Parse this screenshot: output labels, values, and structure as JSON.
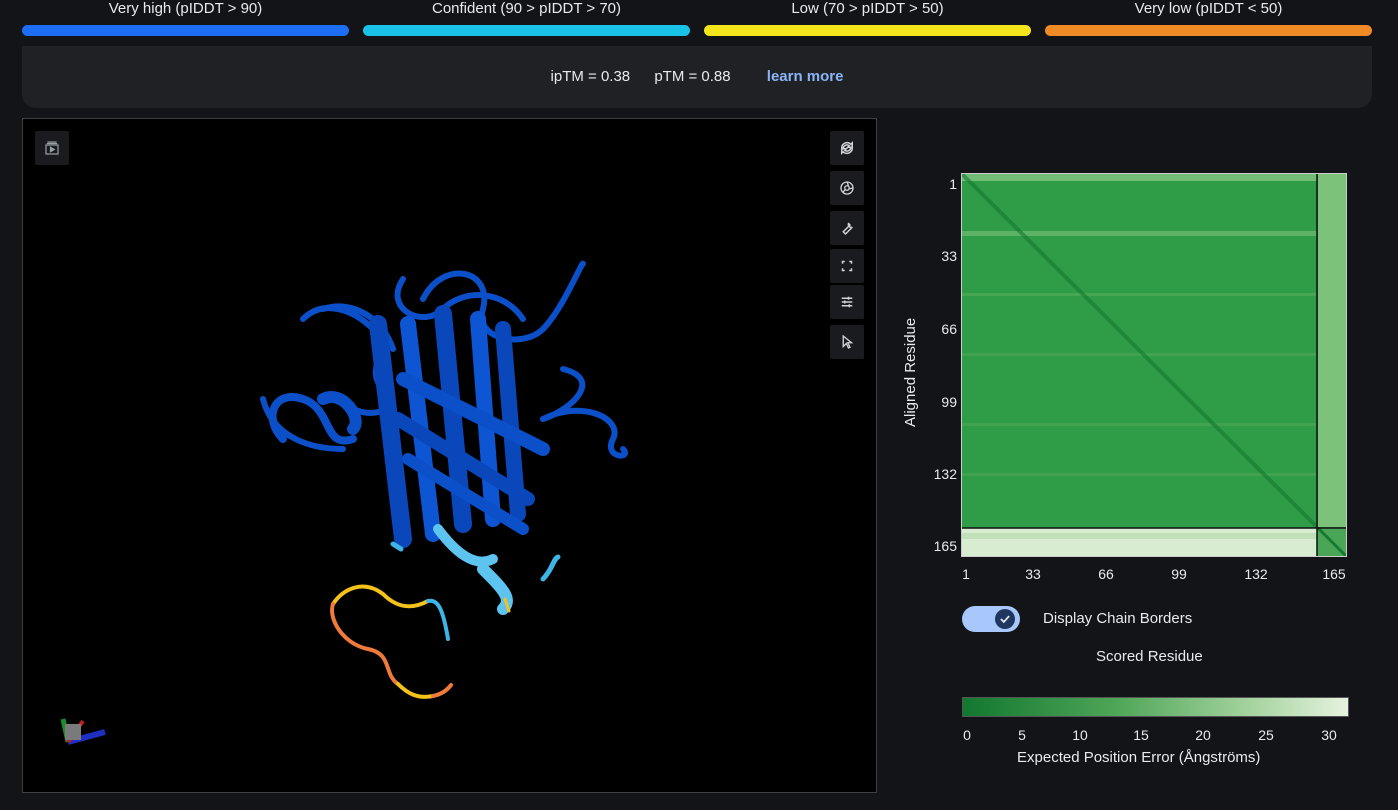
{
  "legend": [
    {
      "label": "Very high (pIDDT > 90)",
      "color": "#1e6ef5"
    },
    {
      "label": "Confident (90 > pIDDT > 70)",
      "color": "#19c3e8"
    },
    {
      "label": "Low (70 > pIDDT > 50)",
      "color": "#f5e51d"
    },
    {
      "label": "Very low (pIDDT < 50)",
      "color": "#f08a25"
    }
  ],
  "scores": {
    "iptm": "ipTM = 0.38",
    "ptm": "pTM = 0.88",
    "learn_more": "learn more"
  },
  "viewer": {
    "toolbar_left": "play-panel-icon",
    "toolbar_right": [
      "refresh-icon",
      "camera-icon",
      "wrench-icon",
      "fullscreen-icon",
      "settings-sliders-icon",
      "cursor-icon"
    ]
  },
  "pae": {
    "y_axis_title": "Aligned Residue",
    "x_axis_title": "Scored Residue",
    "ticks": [
      "1",
      "33",
      "66",
      "99",
      "132",
      "165"
    ],
    "toggle_label": "Display Chain Borders",
    "toggle_on": true,
    "colorbar_ticks": [
      "0",
      "5",
      "10",
      "15",
      "20",
      "25",
      "30"
    ],
    "colorbar_title": "Expected Position Error (Ångströms)"
  }
}
